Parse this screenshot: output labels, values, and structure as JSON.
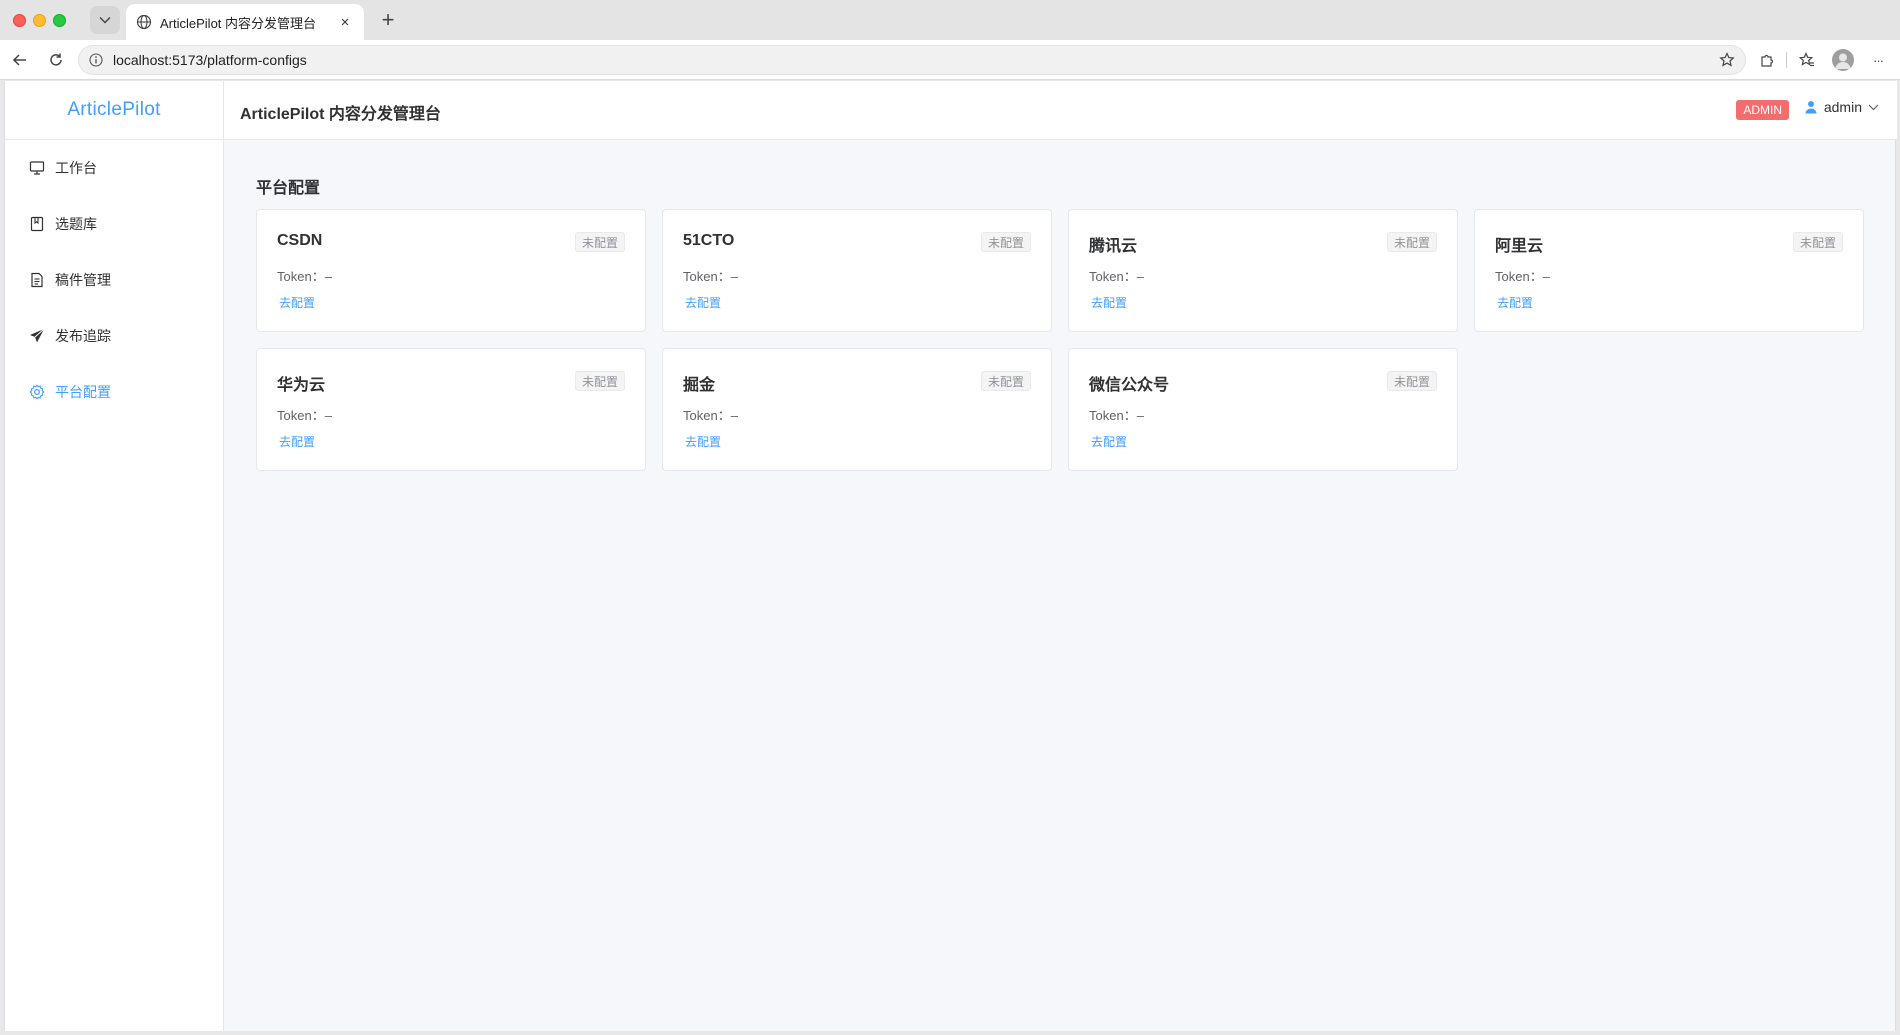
{
  "browser": {
    "tab_title": "ArticlePilot 内容分发管理台",
    "tab_close": "×",
    "new_tab": "+",
    "url": "localhost:5173/platform-configs",
    "more": "···"
  },
  "app": {
    "logo": "ArticlePilot",
    "header_title": "ArticlePilot 内容分发管理台",
    "role_badge": "ADMIN",
    "username": "admin"
  },
  "sidebar": {
    "items": [
      {
        "label": "工作台",
        "icon": "monitor-icon",
        "active": false
      },
      {
        "label": "选题库",
        "icon": "bookmark-icon",
        "active": false
      },
      {
        "label": "稿件管理",
        "icon": "document-icon",
        "active": false
      },
      {
        "label": "发布追踪",
        "icon": "send-icon",
        "active": false
      },
      {
        "label": "平台配置",
        "icon": "gear-icon",
        "active": true
      }
    ]
  },
  "page": {
    "title": "平台配置",
    "cards": [
      {
        "name": "CSDN",
        "status": "未配置",
        "token_label": "Token：",
        "token_value": "–",
        "action": "去配置"
      },
      {
        "name": "51CTO",
        "status": "未配置",
        "token_label": "Token：",
        "token_value": "–",
        "action": "去配置"
      },
      {
        "name": "腾讯云",
        "status": "未配置",
        "token_label": "Token：",
        "token_value": "–",
        "action": "去配置"
      },
      {
        "name": "阿里云",
        "status": "未配置",
        "token_label": "Token：",
        "token_value": "–",
        "action": "去配置"
      },
      {
        "name": "华为云",
        "status": "未配置",
        "token_label": "Token：",
        "token_value": "–",
        "action": "去配置"
      },
      {
        "name": "掘金",
        "status": "未配置",
        "token_label": "Token：",
        "token_value": "–",
        "action": "去配置"
      },
      {
        "name": "微信公众号",
        "status": "未配置",
        "token_label": "Token：",
        "token_value": "–",
        "action": "去配置"
      }
    ]
  },
  "colors": {
    "accent": "#409eff",
    "danger": "#f56c6c",
    "page_bg": "#f5f7fa"
  }
}
